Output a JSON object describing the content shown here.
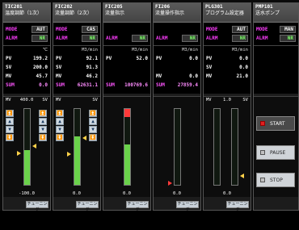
{
  "panels": [
    {
      "tag": "TIC201",
      "desc": "温度調節（1次）",
      "mode_label": "MODE",
      "mode_value": "AUT",
      "alarm_label": "ALRM",
      "alarm_value": "NR",
      "unit": "℃",
      "pv_label": "PV",
      "pv": "199.2",
      "sv_label": "SV",
      "sv": "200.0",
      "mv_label": "MV",
      "mv": "45.7",
      "sum_label": "SUM",
      "sum": "0.0",
      "gauge_left_label": "MV",
      "gauge_top_value": "400.0",
      "gauge_right_label": "SV",
      "gauge_bottom": "-100.0",
      "mv_level": 0.46,
      "tuning": "チューニング"
    },
    {
      "tag": "FIC202",
      "desc": "流量調節（2次）",
      "mode_label": "MODE",
      "mode_value": "CAS",
      "alarm_label": "ALRM",
      "alarm_value": "NR",
      "unit": "M3/min",
      "pv_label": "PV",
      "pv": "92.1",
      "sv_label": "SV",
      "sv": "91.3",
      "mv_label": "MV",
      "mv": "46.2",
      "sum_label": "SUM",
      "sum": "62631.1",
      "gauge_left_label": "MV",
      "gauge_right_label": "SV",
      "gauge_bottom": "0.0",
      "mv_level": 0.64,
      "tuning": "チューニング"
    },
    {
      "tag": "FIC205",
      "desc": "流量指示",
      "alarm_label": "ALRM",
      "alarm_value": "NR",
      "unit": "M3/min",
      "pv_label": "PV",
      "pv": "52.0",
      "sum_label": "SUM",
      "sum": "100769.6",
      "gauge_bottom": "0.0",
      "mv_level": 0.53,
      "tuning": "チューニング"
    },
    {
      "tag": "FI206",
      "desc": "流量操作指示",
      "alarm_label": "ALRM",
      "alarm_value": "NR",
      "unit": "M3/min",
      "pv_label": "PV",
      "pv": "0.0",
      "mv_label": "MV",
      "mv": "0.0",
      "sum_label": "SUM",
      "sum": "27859.4",
      "gauge_bottom": "0.0",
      "mv_level": 0.0,
      "tuning": "チューニング"
    },
    {
      "tag": "PLG301",
      "desc": "プログラム設定器",
      "mode_label": "MODE",
      "mode_value": "AUT",
      "alarm_label": "ALRM",
      "alarm_value": "NR",
      "unit": "M3/min",
      "pv_label": "PV",
      "pv": "0.0",
      "sv_label": "SV",
      "sv": "0.0",
      "mv_label": "MV",
      "mv": "21.0",
      "gauge_left_label": "MV",
      "gauge_right_label": "SV",
      "gauge_top_value": "1.0",
      "gauge_bottom": "0.0",
      "mv_level": 0.0,
      "tuning": "チューニング"
    },
    {
      "tag": "PMP101",
      "desc": "送水ポンプ",
      "mode_label": "MODE",
      "mode_value": "MAN",
      "alarm_label": "ALRM",
      "alarm_value": "NR",
      "buttons": [
        "START",
        "PAUSE",
        "STOP"
      ]
    }
  ]
}
